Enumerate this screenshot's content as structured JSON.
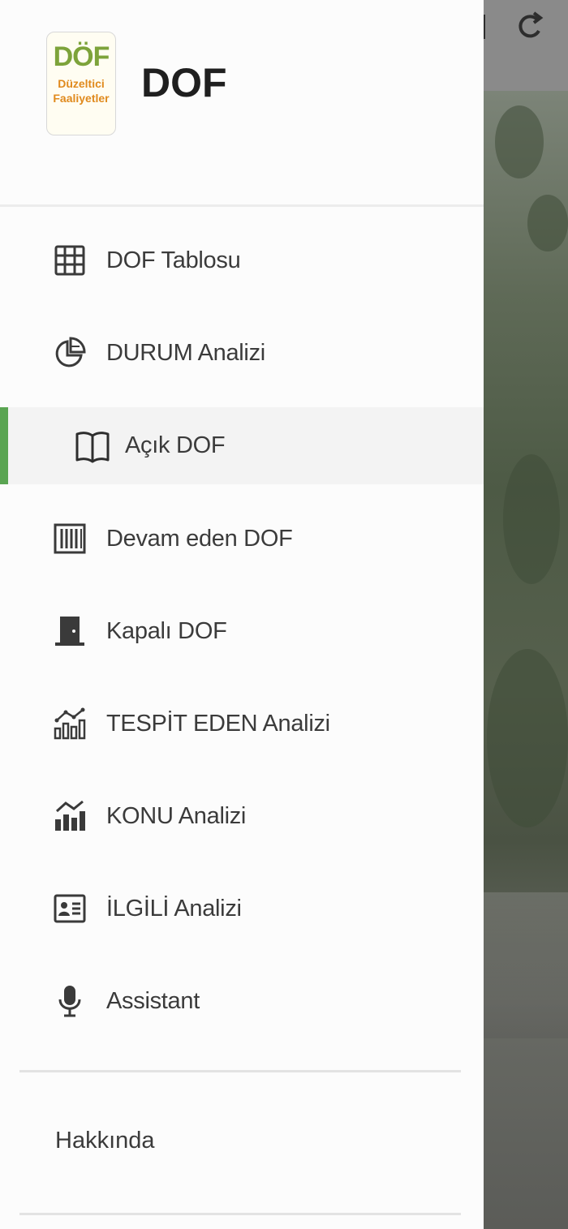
{
  "app": {
    "title": "DOF",
    "logo": {
      "line1": "DÖF",
      "line2": "Düzeltici",
      "line3": "Faaliyetler"
    }
  },
  "colors": {
    "active_indicator": "#5aa552",
    "logo_green": "#7da33a",
    "logo_orange": "#e08a1d"
  },
  "menu": {
    "items": [
      {
        "label": "DOF Tablosu",
        "icon": "table-grid-icon"
      },
      {
        "label": "DURUM Analizi",
        "icon": "pie-chart-icon"
      },
      {
        "label": "Açık DOF",
        "icon": "open-book-icon",
        "active": true
      },
      {
        "label": "Devam eden DOF",
        "icon": "barcode-columns-icon"
      },
      {
        "label": "Kapalı DOF",
        "icon": "door-closed-icon"
      },
      {
        "label": "TESPİT EDEN Analizi",
        "icon": "trend-bars-outline-icon"
      },
      {
        "label": "KONU Analizi",
        "icon": "trend-bars-filled-icon"
      },
      {
        "label": "İLGİLİ Analizi",
        "icon": "contact-card-icon"
      },
      {
        "label": "Assistant",
        "icon": "microphone-icon"
      }
    ],
    "footer_item": "Hakkında"
  }
}
